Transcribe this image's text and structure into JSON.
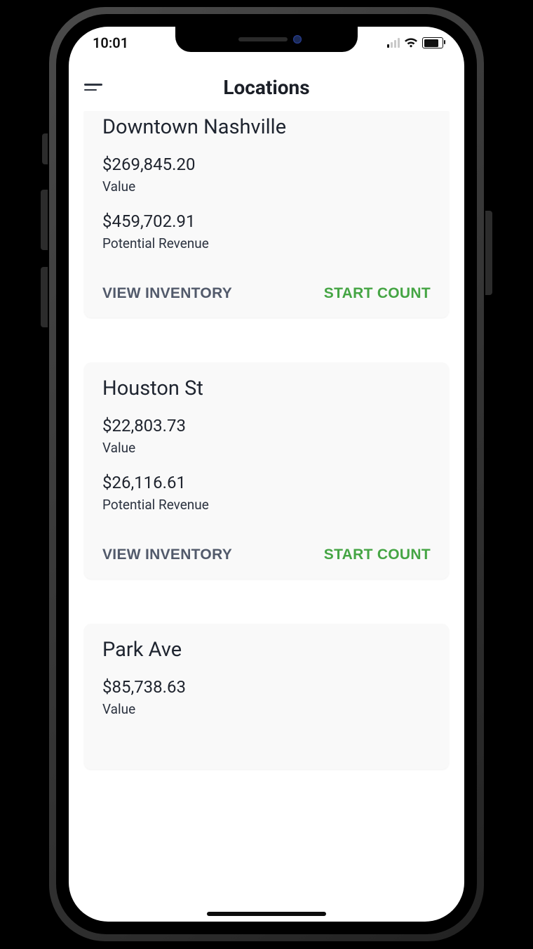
{
  "status": {
    "time": "10:01"
  },
  "header": {
    "title": "Locations"
  },
  "labels": {
    "value": "Value",
    "potential_revenue": "Potential Revenue",
    "view_inventory": "VIEW INVENTORY",
    "start_count": "START COUNT"
  },
  "locations": [
    {
      "name": "Downtown Nashville",
      "value": "$269,845.20",
      "potential_revenue": "$459,702.91"
    },
    {
      "name": "Houston St",
      "value": "$22,803.73",
      "potential_revenue": "$26,116.61"
    },
    {
      "name": "Park Ave",
      "value": "$85,738.63",
      "potential_revenue": ""
    }
  ]
}
